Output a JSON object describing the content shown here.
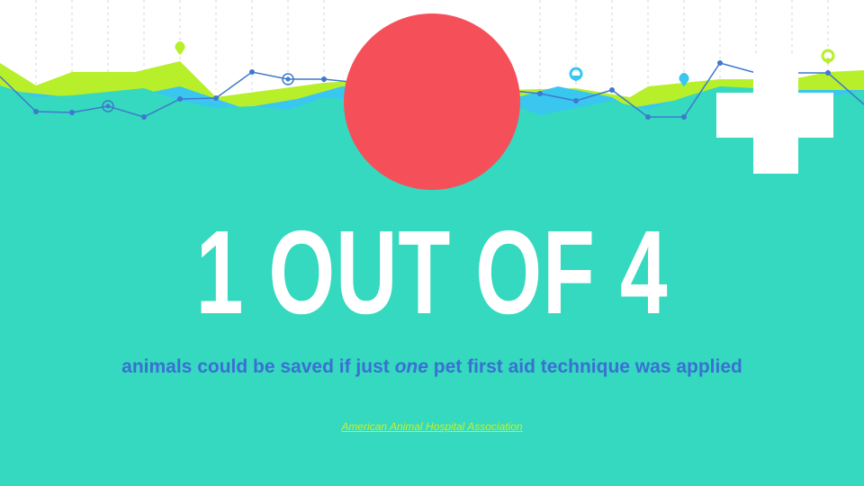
{
  "colors": {
    "background": "#34d9bf",
    "lime": "#b7ef2b",
    "sky": "#39c7f0",
    "line": "#3f78cf",
    "badge": "#f5505a",
    "subtitle": "#3a6fd3",
    "link": "#c4f02d"
  },
  "badge": {
    "icon": "medical-cross-icon"
  },
  "headline": "1 OUT OF 4",
  "subtitle": {
    "before": "animals could be saved if just ",
    "emphasis": "one",
    "after": " pet first aid technique was applied"
  },
  "source": "American Animal Hospital Association"
}
